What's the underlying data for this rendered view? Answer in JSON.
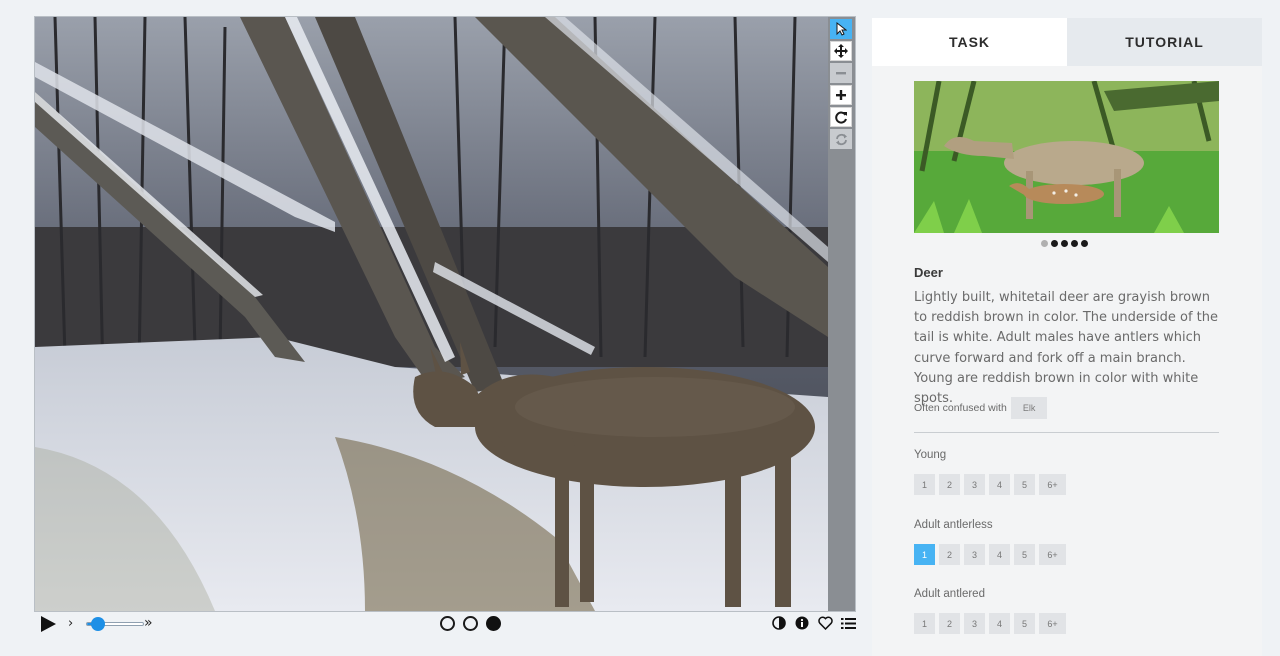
{
  "viewer": {
    "tools": [
      "pointer-icon",
      "move-icon",
      "zoom-out-icon",
      "zoom-in-icon",
      "rotate-icon",
      "reset-icon"
    ],
    "frames": [
      "frame-1",
      "frame-2",
      "frame-3"
    ],
    "active_frame_index": 2,
    "playback_rate_fraction": 0.2,
    "prev_rate_glyph": "›",
    "next_rate_glyph": "»",
    "right_icons": [
      "contrast-icon",
      "info-icon",
      "heart-icon",
      "list-icon"
    ]
  },
  "tabs": {
    "task": "TASK",
    "tutorial": "TUTORIAL"
  },
  "species": {
    "name": "Deer",
    "description": "Lightly built, whitetail deer are grayish brown to reddish brown in color. The underside of the tail is white. Adult males have antlers which curve forward and fork off a main branch. Young are reddish brown in color with white spots.",
    "confused_label": "Often confused with",
    "confused_with": "Elk",
    "carousel_count": 5,
    "carousel_active": 0
  },
  "questions": [
    {
      "label": "Young",
      "options": [
        "1",
        "2",
        "3",
        "4",
        "5",
        "6+"
      ],
      "selected": null
    },
    {
      "label": "Adult antlerless",
      "options": [
        "1",
        "2",
        "3",
        "4",
        "5",
        "6+"
      ],
      "selected": "1"
    },
    {
      "label": "Adult antlered",
      "options": [
        "1",
        "2",
        "3",
        "4",
        "5",
        "6+"
      ],
      "selected": null
    }
  ],
  "colors": {
    "accent": "#47b3f3",
    "slider": "#1d8fe6"
  }
}
